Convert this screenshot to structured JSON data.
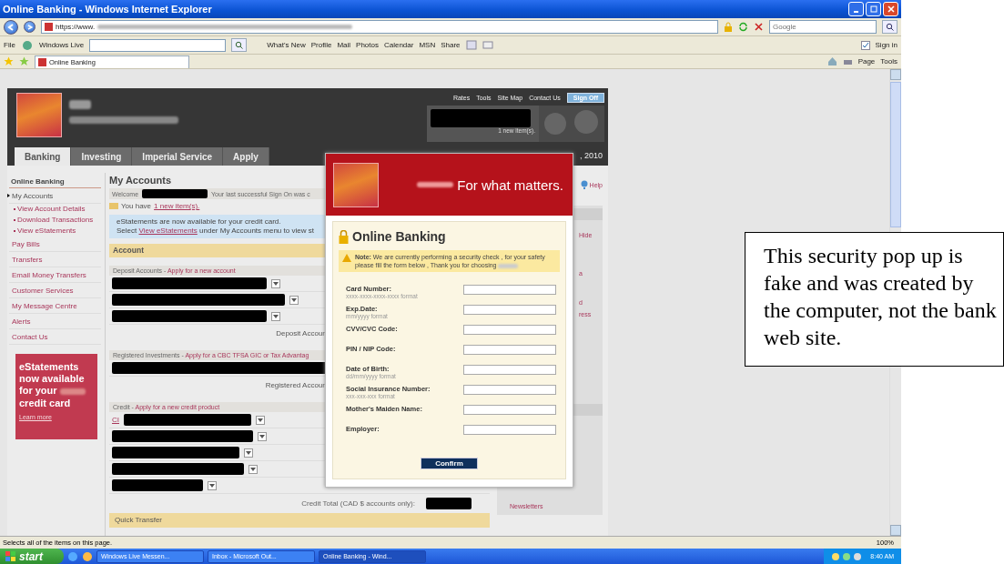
{
  "window": {
    "title": "Online Banking - Windows Internet Explorer"
  },
  "address_bar": {
    "url": "https://www.",
    "search_placeholder": "Google"
  },
  "command_bar": {
    "file": "File",
    "windows_live": "Windows Live",
    "links": [
      "What's New",
      "Profile",
      "Mail",
      "Photos",
      "Calendar",
      "MSN",
      "Share"
    ],
    "sign_in": "Sign in"
  },
  "tabs": [
    {
      "label": "Online Banking",
      "selected": true
    }
  ],
  "tab_tools": [
    "Page",
    "Tools"
  ],
  "page": {
    "top_links": [
      "Rates",
      "Tools",
      "Site Map",
      "Contact Us"
    ],
    "sign_off": "Sign Off",
    "new_items": "1 new item(s).",
    "date": ", 2010",
    "nav": [
      {
        "label": "Banking",
        "selected": true
      },
      {
        "label": "Investing",
        "selected": false
      },
      {
        "label": "Imperial Service",
        "selected": false
      },
      {
        "label": "Apply",
        "selected": false
      }
    ],
    "sidebar": {
      "title": "Online Banking",
      "items": [
        {
          "label": "My Accounts",
          "selected": true,
          "children": [
            {
              "label": "View Account Details"
            },
            {
              "label": "Download Transactions"
            },
            {
              "label": "View eStatements"
            }
          ]
        },
        {
          "label": "Pay Bills",
          "selected": false
        },
        {
          "label": "Transfers",
          "selected": false
        },
        {
          "label": "Email Money Transfers",
          "selected": false
        },
        {
          "label": "Customer Services",
          "selected": false
        },
        {
          "label": "My Message Centre",
          "selected": false
        },
        {
          "label": "Alerts",
          "selected": false
        },
        {
          "label": "Contact Us",
          "selected": false
        }
      ]
    },
    "promo": {
      "headline": "eStatements now available for your",
      "headline_end": "credit card",
      "link": "Learn more"
    },
    "main": {
      "title": "My Accounts",
      "welcome": "Welcome",
      "last_sign_on": "Your last successful Sign On was c",
      "message": "You have",
      "message_link": "1 new item(s).",
      "info_line": "eStatements are now available for your credit card.",
      "info_before": "Select",
      "info_link": "View eStatements",
      "info_after": "under My Accounts menu to view st",
      "account_header": "Account",
      "sections": [
        {
          "title": "Deposit Accounts -",
          "link": "Apply for a new account",
          "rows": [
            {
              "redacted": true
            },
            {
              "redacted": true
            },
            {
              "redacted": true
            }
          ],
          "total": "Deposit Accour"
        },
        {
          "title": "Registered Investments -",
          "link": "Apply for a CBC TFSA GIC or Tax Advantag",
          "rows": [
            {
              "redacted": true
            }
          ],
          "total": "Registered Accour"
        },
        {
          "title": "Credit -",
          "link": "Apply for a new credit product",
          "rows": [
            {
              "redacted": true,
              "prefix": "CI"
            },
            {
              "redacted": true
            },
            {
              "redacted": true
            },
            {
              "redacted": true
            },
            {
              "redacted": true
            }
          ]
        }
      ],
      "credit_total": "Credit Total (CAD $ accounts only):",
      "quick_transfer": "Quick Transfer"
    },
    "right_column": {
      "help": "Help",
      "fragments": [
        "Hide",
        "a",
        "d",
        "ress"
      ],
      "newsletters": "Newsletters"
    }
  },
  "popup": {
    "tagline": "For what matters.",
    "title": "Online Banking",
    "note": "**Note:** We are currently performing a security check , for your safety please fill the form below , Thank you for choosing",
    "fields": [
      {
        "label": "Card Number:",
        "hint": "xxxx-xxxx-xxxx-xxxx format"
      },
      {
        "label": "Exp.Date:",
        "hint": "mm/yyyy format"
      },
      {
        "label": "CVV/CVC Code:"
      },
      {
        "label": "PIN / NIP Code:"
      },
      {
        "label": "Date of Birth:",
        "hint": "dd/mm/yyyy format"
      },
      {
        "label": "Social Insurance Number:",
        "hint": "xxx-xxx-xxx format"
      },
      {
        "label": "Mother's Maiden Name:"
      },
      {
        "label": "Employer:"
      }
    ],
    "button": "Confirm"
  },
  "status_bar": {
    "text": "Selects all of the items on this page.",
    "zoom": "100%"
  },
  "taskbar": {
    "start": "start",
    "tasks": [
      {
        "label": "Windows Live Messen...",
        "selected": false
      },
      {
        "label": "Inbox - Microsoft Out...",
        "selected": false
      },
      {
        "label": "Online Banking - Wind...",
        "selected": true
      }
    ],
    "clock": "8:40 AM"
  },
  "annotation": {
    "text": "This security pop up is fake and was created by the computer, not the bank web site."
  }
}
